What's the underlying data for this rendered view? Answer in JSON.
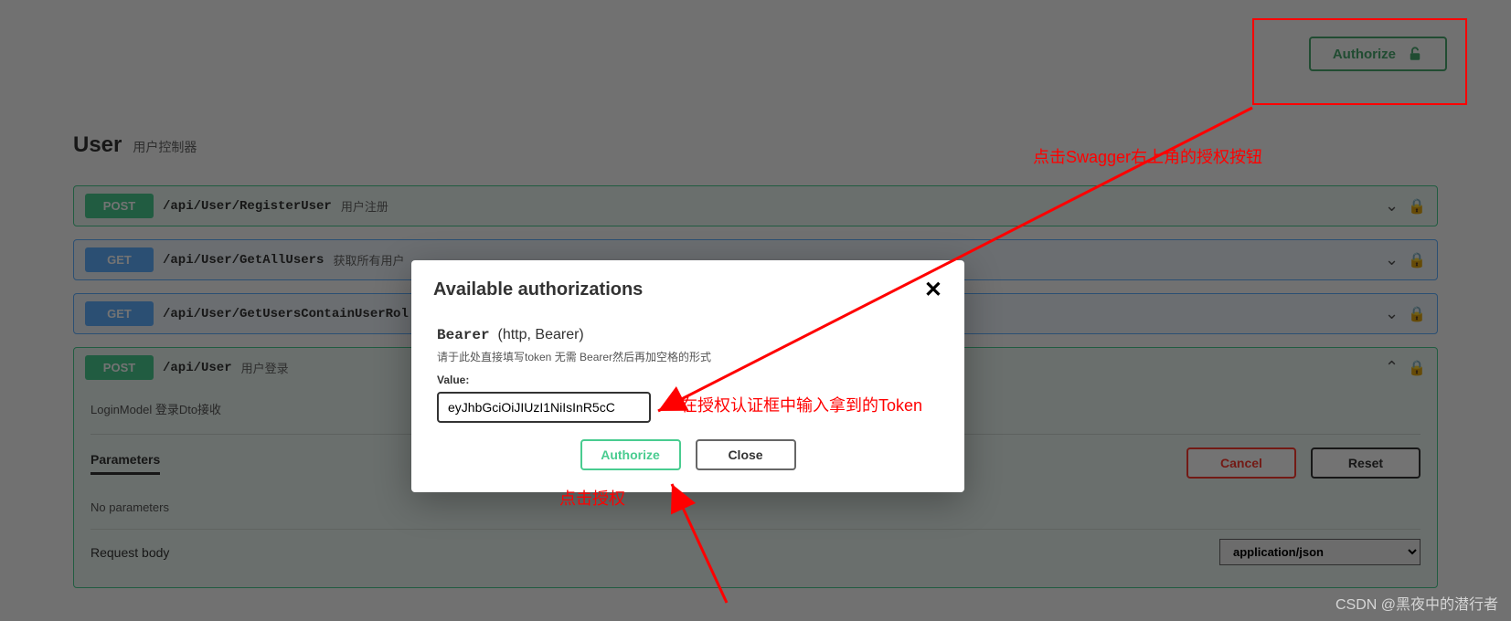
{
  "topbar": {
    "authorize_label": "Authorize"
  },
  "section": {
    "title": "User",
    "subtitle": "用户控制器"
  },
  "ops": [
    {
      "method": "POST",
      "path": "/api/User/RegisterUser",
      "desc": "用户注册"
    },
    {
      "method": "GET",
      "path": "/api/User/GetAllUsers",
      "desc": "获取所有用户"
    },
    {
      "method": "GET",
      "path": "/api/User/GetUsersContainUserRol",
      "desc": ""
    },
    {
      "method": "POST",
      "path": "/api/User",
      "desc": "用户登录"
    }
  ],
  "expanded": {
    "dto": "LoginModel 登录Dto接收",
    "parameters": "Parameters",
    "cancel": "Cancel",
    "reset": "Reset",
    "noparams": "No parameters",
    "request_body": "Request body",
    "content_type": "application/json"
  },
  "modal": {
    "title": "Available authorizations",
    "scheme_name": "Bearer",
    "scheme_type": "(http, Bearer)",
    "note": "请于此处直接填写token 无需 Bearer然后再加空格的形式",
    "value_label": "Value:",
    "token_value": "eyJhbGciOiJIUzI1NiIsInR5cC",
    "authorize": "Authorize",
    "close": "Close"
  },
  "annotations": {
    "top": "点击Swagger右上角的授权按钮",
    "mid": "在授权认证框中输入拿到的Token",
    "bottom": "点击授权"
  },
  "watermark": "CSDN @黑夜中的潜行者"
}
